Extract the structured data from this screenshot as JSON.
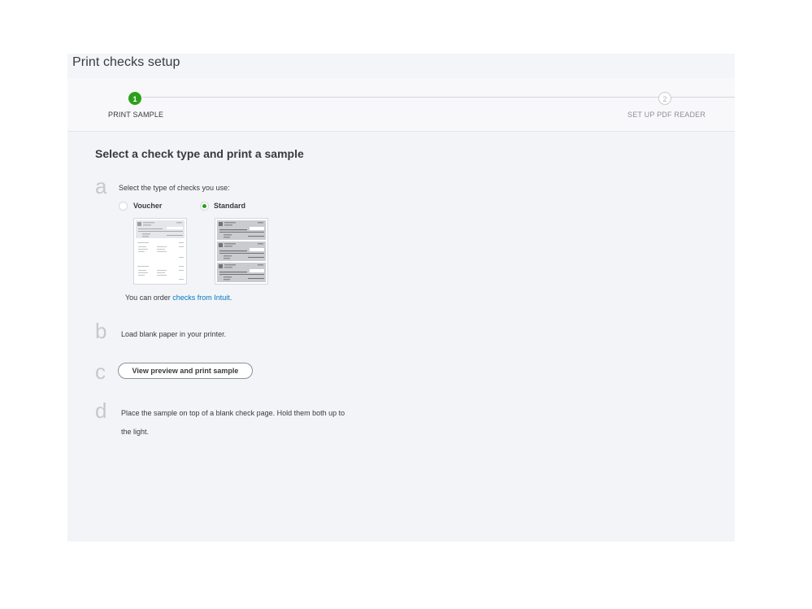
{
  "window": {
    "title": "Print checks setup"
  },
  "stepper": {
    "steps": [
      {
        "number": "1",
        "label": "PRINT SAMPLE",
        "state": "active"
      },
      {
        "number": "2",
        "label": "SET UP PDF READER",
        "state": "inactive"
      }
    ]
  },
  "main": {
    "heading": "Select a check type and print a sample",
    "steps": {
      "a": {
        "letter": "a",
        "instruction": "Select the type of checks you use:",
        "options": [
          {
            "label": "Voucher",
            "selected": false
          },
          {
            "label": "Standard",
            "selected": true
          }
        ],
        "order_prefix": "You can order ",
        "order_link": "checks from Intuit",
        "order_suffix": "."
      },
      "b": {
        "letter": "b",
        "instruction": "Load blank paper in your printer."
      },
      "c": {
        "letter": "c",
        "button_label": "View preview and print sample"
      },
      "d": {
        "letter": "d",
        "instruction_line1": "Place the sample on top of a blank check page. Hold them both up to",
        "instruction_line2": "the light."
      }
    }
  },
  "colors": {
    "accent_green": "#2ca01c",
    "link_blue": "#0077c5",
    "panel_bg": "#f3f4f7",
    "text": "#393a3d"
  },
  "icons": {
    "voucher_thumbnail": "voucher-check-thumbnail",
    "standard_thumbnail": "standard-check-thumbnail"
  }
}
